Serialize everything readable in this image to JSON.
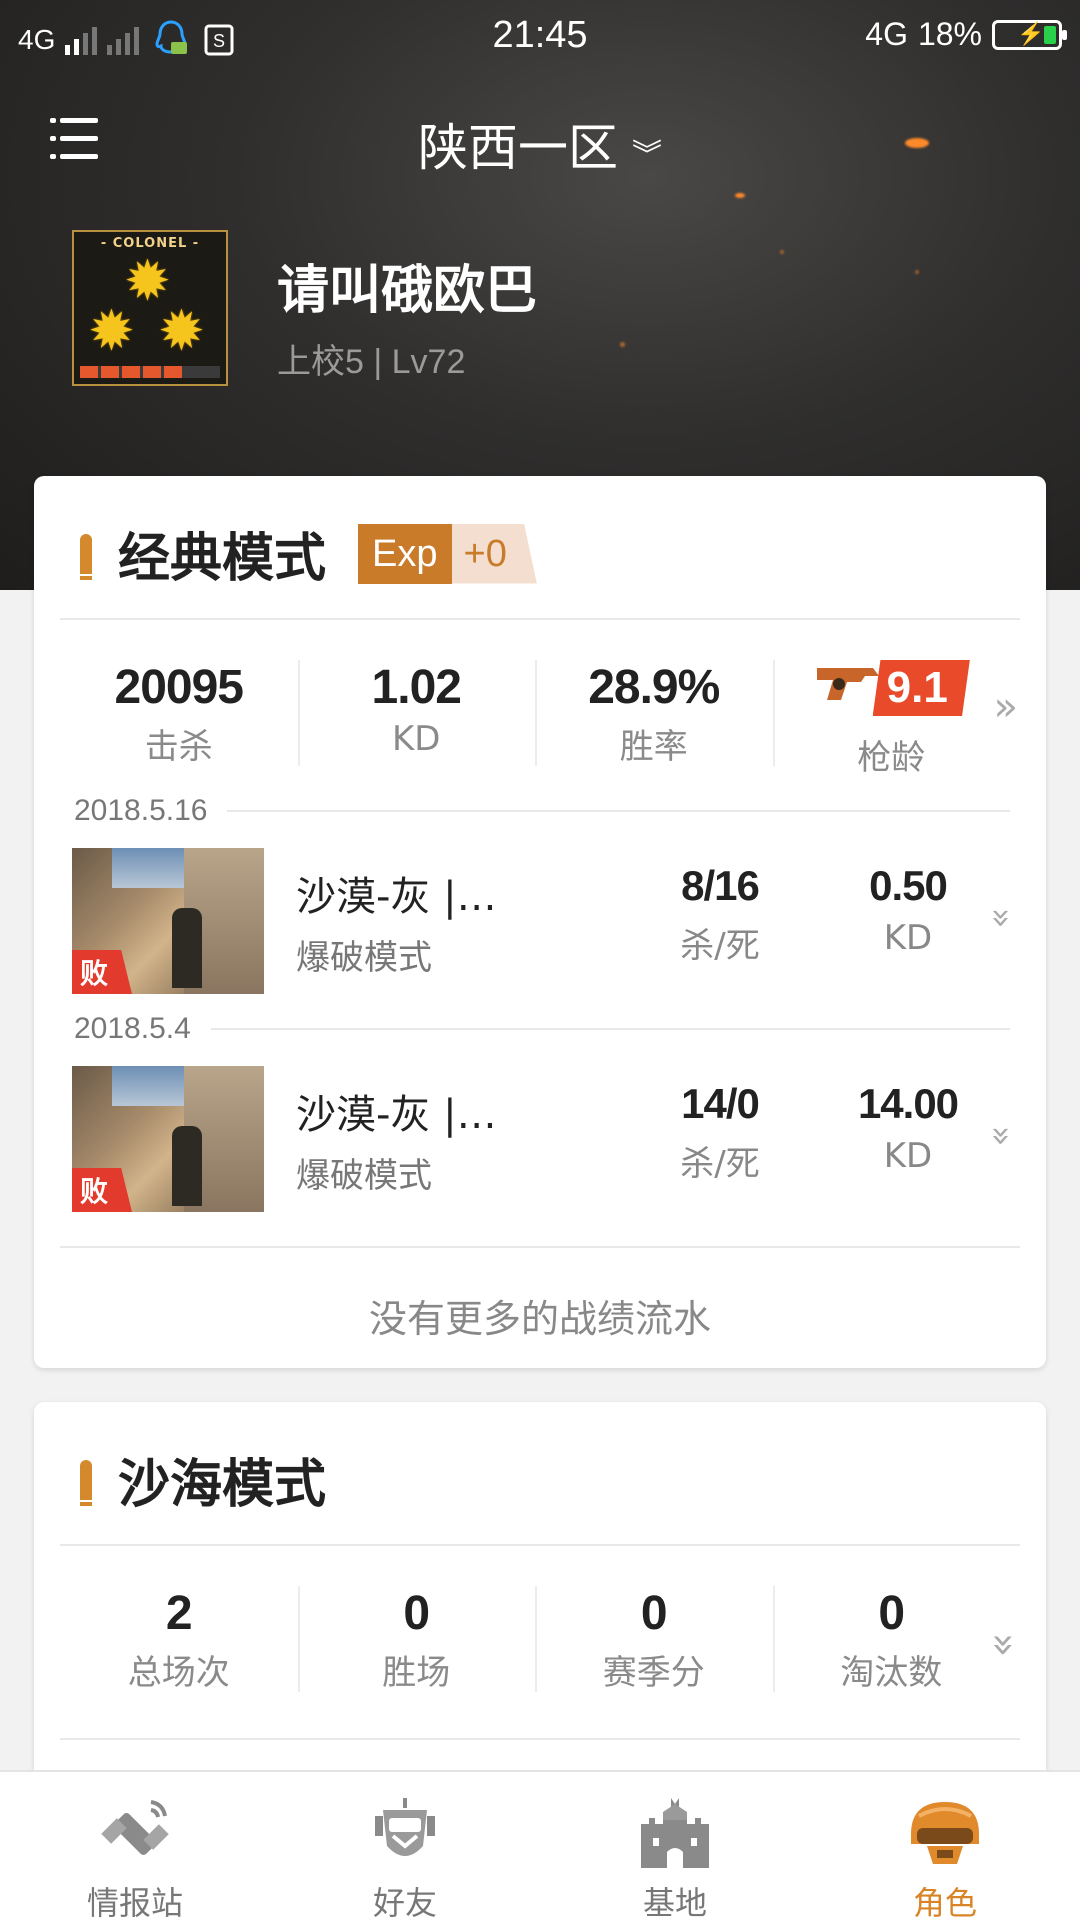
{
  "status_bar": {
    "network_left": "4G",
    "time": "21:45",
    "network_right": "4G",
    "battery": "18%"
  },
  "header": {
    "server": "陕西一区"
  },
  "profile": {
    "rank_badge_text": "COLONEL",
    "name": "请叫硪欧巴",
    "rank_level": "上校5 | Lv72"
  },
  "classic": {
    "title": "经典模式",
    "exp_label": "Exp",
    "exp_value": "+0",
    "stats": [
      {
        "value": "20095",
        "label": "击杀"
      },
      {
        "value": "1.02",
        "label": "KD"
      },
      {
        "value": "28.9%",
        "label": "胜率"
      }
    ],
    "gun_age": {
      "value": "9.1",
      "label": "枪龄"
    },
    "matches": [
      {
        "date": "2018.5.16",
        "result": "败",
        "map": "沙漠-灰 |…",
        "mode": "爆破模式",
        "kd_ratio": "8/16",
        "kd_ratio_label": "杀/死",
        "kd": "0.50",
        "kd_label": "KD"
      },
      {
        "date": "2018.5.4",
        "result": "败",
        "map": "沙漠-灰 |…",
        "mode": "爆破模式",
        "kd_ratio": "14/0",
        "kd_ratio_label": "杀/死",
        "kd": "14.00",
        "kd_label": "KD"
      }
    ],
    "no_more": "没有更多的战绩流水"
  },
  "sand": {
    "title": "沙海模式",
    "stats": [
      {
        "value": "2",
        "label": "总场次"
      },
      {
        "value": "0",
        "label": "胜场"
      },
      {
        "value": "0",
        "label": "赛季分"
      },
      {
        "value": "0",
        "label": "淘汰数"
      }
    ]
  },
  "bottom_nav": [
    {
      "label": "情报站",
      "icon": "satellite-icon"
    },
    {
      "label": "好友",
      "icon": "robot-icon"
    },
    {
      "label": "基地",
      "icon": "castle-icon"
    },
    {
      "label": "角色",
      "icon": "helmet-icon"
    }
  ],
  "colors": {
    "accent": "#d98527",
    "lose": "#e23a2c",
    "gun_badge": "#e94a2a"
  }
}
